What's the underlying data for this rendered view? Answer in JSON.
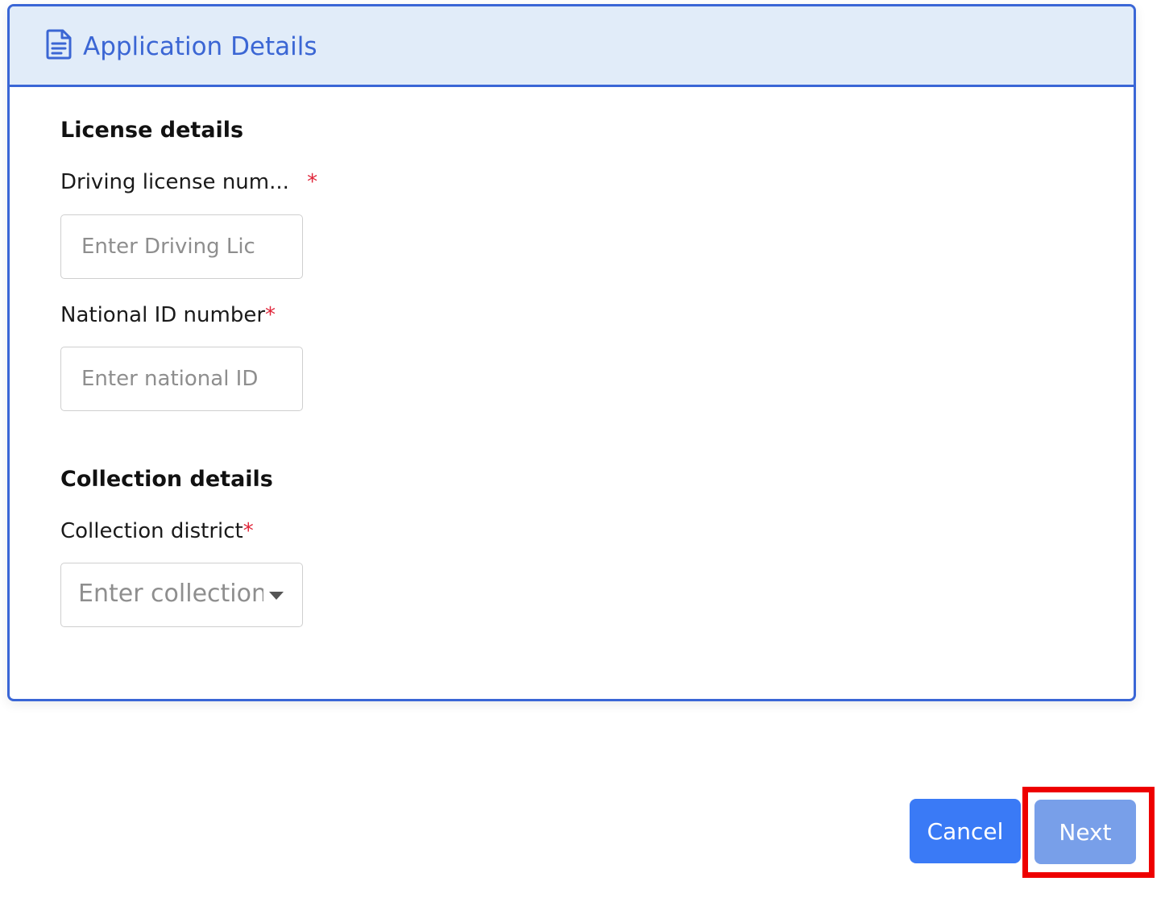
{
  "header": {
    "icon": "document-icon",
    "title": "Application Details"
  },
  "license_section": {
    "title": "License details",
    "driving_license": {
      "label": "Driving license num...",
      "required_mark": "*",
      "placeholder": "Enter Driving Lic",
      "value": ""
    },
    "national_id": {
      "label": "National ID number",
      "required_mark": "*",
      "placeholder": "Enter national ID",
      "value": ""
    }
  },
  "collection_section": {
    "title": "Collection details",
    "district": {
      "label": "Collection district",
      "required_mark": "*",
      "placeholder": "Enter collection district",
      "icon": "caret-down-icon"
    }
  },
  "actions": {
    "cancel_label": "Cancel",
    "next_label": "Next"
  },
  "colors": {
    "accent": "#3a66d6",
    "header_bg": "#e1ecf9",
    "cancel_bg": "#3a7af6",
    "next_bg": "#789fe9",
    "required": "#e0263a",
    "highlight": "#ee0000"
  }
}
